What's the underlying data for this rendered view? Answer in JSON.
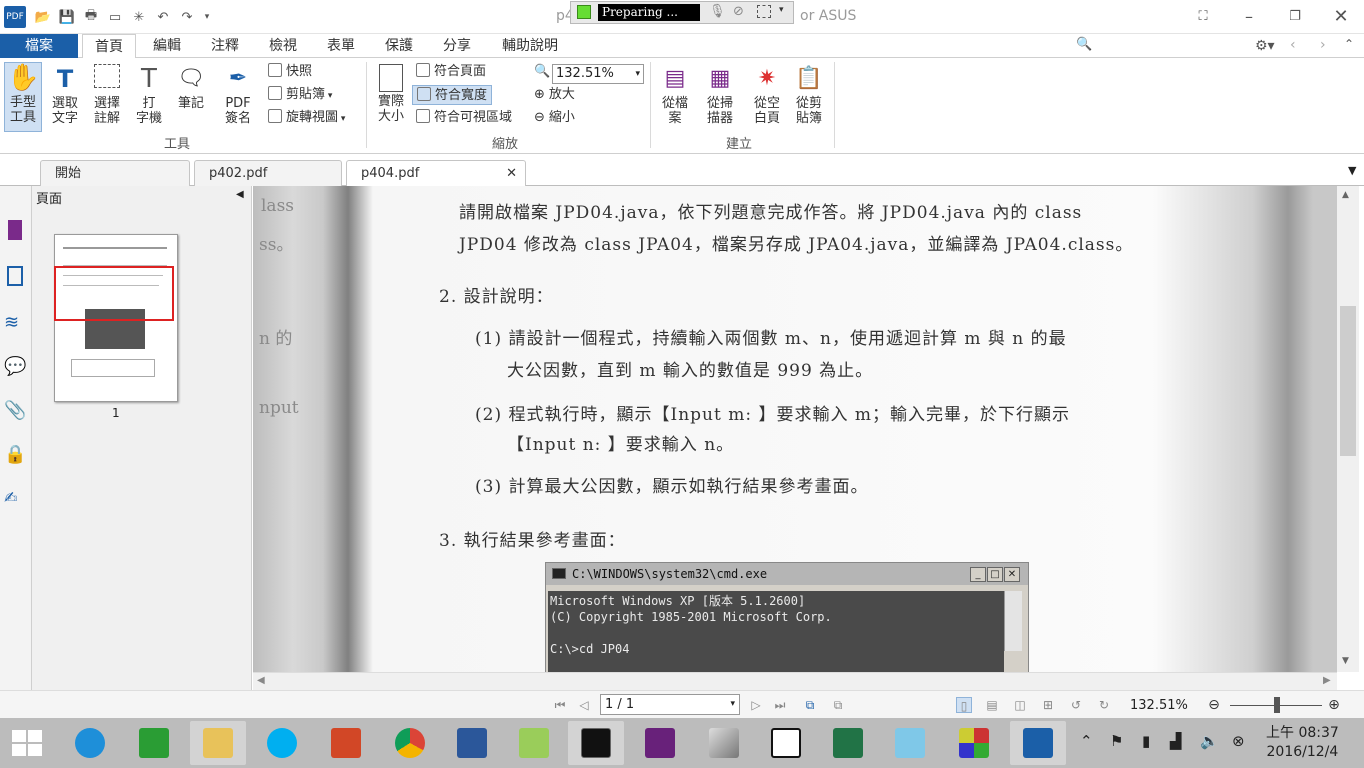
{
  "titlebar": {
    "title_left": "p4",
    "title_right": "or ASUS",
    "recorder_status": "Preparing ..."
  },
  "ribbon_tabs": [
    "檔案",
    "首頁",
    "編輯",
    "注釋",
    "檢視",
    "表單",
    "保護",
    "分享",
    "輔助說明"
  ],
  "search": {
    "placeholder": "尋找"
  },
  "tools_group": {
    "label": "工具",
    "hand": "手型\n工具",
    "select_text": "選取\n文字",
    "select_annot": "選擇\n註解",
    "typewriter": "打\n字機",
    "note": "筆記",
    "pdf_sign": "PDF\n簽名",
    "snapshot": "快照",
    "clipboard": "剪貼簿",
    "rotate": "旋轉視圖"
  },
  "zoom_group": {
    "label": "縮放",
    "actual_size": "實際\n大小",
    "fit_page": "符合頁面",
    "fit_width": "符合寬度",
    "fit_visible": "符合可視區域",
    "zoom_value": "132.51%",
    "zoom_in": "放大",
    "zoom_out": "縮小"
  },
  "create_group": {
    "label": "建立",
    "from_file": "從檔\n案",
    "from_scanner": "從掃\n描器",
    "blank": "從空\n白頁",
    "from_clipboard": "從剪\n貼簿"
  },
  "doc_tabs": [
    "開始",
    "p402.pdf",
    "p404.pdf"
  ],
  "pages_panel": {
    "title": "頁面",
    "page_number": "1"
  },
  "document": {
    "para1_line1": "請開啟檔案 JPD04.java，依下列題意完成作答。將 JPD04.java 內的 class",
    "para1_line2": "JPD04 修改為 class JPA04，檔案另存成 JPA04.java，並編譯為 JPA04.class。",
    "h2": "2. 設計說明：",
    "item1_line1": "(1) 請設計一個程式，持續輸入兩個數 m、n，使用遞迴計算 m 與 n 的最",
    "item1_line2": "大公因數，直到 m 輸入的數值是 999 為止。",
    "item2_line1": "(2) 程式執行時，顯示【Input m: 】要求輸入 m；輸入完畢，於下行顯示",
    "item2_line2": "【Input n: 】要求輸入 n。",
    "item3": "(3) 計算最大公因數，顯示如執行結果參考畫面。",
    "h3": "3. 執行結果參考畫面：",
    "ghost_left": [
      "lass",
      "ss。",
      "n 的",
      "nput"
    ],
    "cmd_title": "C:\\WINDOWS\\system32\\cmd.exe",
    "cmd_lines": "Microsoft Windows XP [版本 5.1.2600]\n(C) Copyright 1985-2001 Microsoft Corp.\n\nC:\\>cd JP04"
  },
  "statusbar": {
    "page_field": "1 / 1",
    "zoom": "132.51%"
  },
  "taskbar": {
    "clock_time": "上午 08:37",
    "clock_date": "2016/12/4"
  },
  "colors": {
    "accent": "#1b5fa8",
    "selection_red": "#d22222",
    "recorder_green": "#66dd33"
  }
}
